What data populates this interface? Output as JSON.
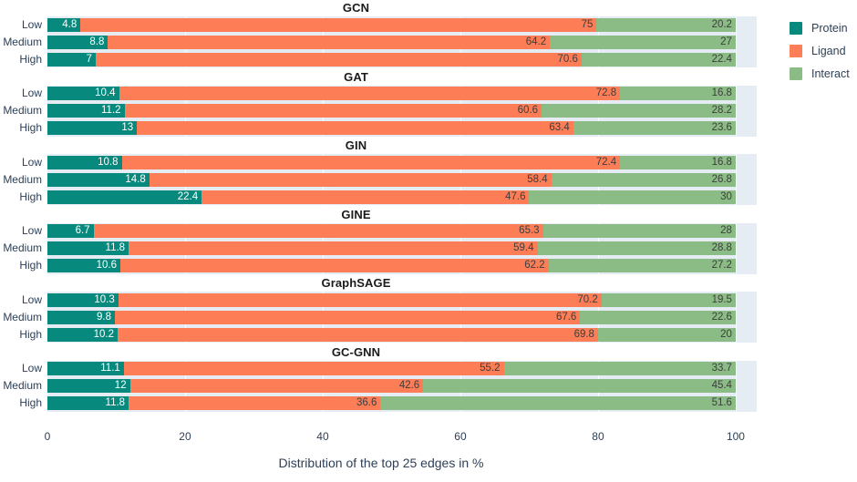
{
  "chart_data": {
    "type": "bar",
    "orientation": "horizontal",
    "stacked": true,
    "normalized": true,
    "title": "",
    "xlabel": "Distribution of the top 25 edges in %",
    "ylabel": "",
    "xlim": [
      0,
      100
    ],
    "xticks": [
      0,
      20,
      40,
      60,
      80,
      100
    ],
    "xticklabels": [
      "0",
      "20",
      "40",
      "60",
      "80",
      "100"
    ],
    "grid": true,
    "legend_position": "right",
    "categories": [
      "Low",
      "Medium",
      "High"
    ],
    "series_names": [
      "Protein",
      "Ligand",
      "Interact"
    ],
    "colors": {
      "Protein": "#078a7d",
      "Ligand": "#fc7d56",
      "Interact": "#8cbc86",
      "panel_background": "#e6ecf3",
      "text": "#2e4057",
      "title": "#1a1a1a"
    },
    "panels": [
      {
        "title": "GCN",
        "rows": [
          {
            "label": "Low",
            "values": [
              4.8,
              75.0,
              20.2
            ],
            "labels": [
              "4.8",
              "75",
              "20.2"
            ]
          },
          {
            "label": "Medium",
            "values": [
              8.8,
              64.2,
              27.0
            ],
            "labels": [
              "8.8",
              "64.2",
              "27"
            ]
          },
          {
            "label": "High",
            "values": [
              7.0,
              70.6,
              22.4
            ],
            "labels": [
              "7",
              "70.6",
              "22.4"
            ]
          }
        ]
      },
      {
        "title": "GAT",
        "rows": [
          {
            "label": "Low",
            "values": [
              10.4,
              72.8,
              16.8
            ],
            "labels": [
              "10.4",
              "72.8",
              "16.8"
            ]
          },
          {
            "label": "Medium",
            "values": [
              11.2,
              60.6,
              28.2
            ],
            "labels": [
              "11.2",
              "60.6",
              "28.2"
            ]
          },
          {
            "label": "High",
            "values": [
              13.0,
              63.4,
              23.6
            ],
            "labels": [
              "13",
              "63.4",
              "23.6"
            ]
          }
        ]
      },
      {
        "title": "GIN",
        "rows": [
          {
            "label": "Low",
            "values": [
              10.8,
              72.4,
              16.8
            ],
            "labels": [
              "10.8",
              "72.4",
              "16.8"
            ]
          },
          {
            "label": "Medium",
            "values": [
              14.8,
              58.4,
              26.8
            ],
            "labels": [
              "14.8",
              "58.4",
              "26.8"
            ]
          },
          {
            "label": "High",
            "values": [
              22.4,
              47.6,
              30.0
            ],
            "labels": [
              "22.4",
              "47.6",
              "30"
            ]
          }
        ]
      },
      {
        "title": "GINE",
        "rows": [
          {
            "label": "Low",
            "values": [
              6.7,
              65.3,
              28.0
            ],
            "labels": [
              "6.7",
              "65.3",
              "28"
            ]
          },
          {
            "label": "Medium",
            "values": [
              11.8,
              59.4,
              28.8
            ],
            "labels": [
              "11.8",
              "59.4",
              "28.8"
            ]
          },
          {
            "label": "High",
            "values": [
              10.6,
              62.2,
              27.2
            ],
            "labels": [
              "10.6",
              "62.2",
              "27.2"
            ]
          }
        ]
      },
      {
        "title": "GraphSAGE",
        "rows": [
          {
            "label": "Low",
            "values": [
              10.3,
              70.2,
              19.5
            ],
            "labels": [
              "10.3",
              "70.2",
              "19.5"
            ]
          },
          {
            "label": "Medium",
            "values": [
              9.8,
              67.6,
              22.6
            ],
            "labels": [
              "9.8",
              "67.6",
              "22.6"
            ]
          },
          {
            "label": "High",
            "values": [
              10.2,
              69.8,
              20.0
            ],
            "labels": [
              "10.2",
              "69.8",
              "20"
            ]
          }
        ]
      },
      {
        "title": "GC-GNN",
        "rows": [
          {
            "label": "Low",
            "values": [
              11.1,
              55.2,
              33.7
            ],
            "labels": [
              "11.1",
              "55.2",
              "33.7"
            ]
          },
          {
            "label": "Medium",
            "values": [
              12.0,
              42.6,
              45.4
            ],
            "labels": [
              "12",
              "42.6",
              "45.4"
            ]
          },
          {
            "label": "High",
            "values": [
              11.8,
              36.6,
              51.6
            ],
            "labels": [
              "11.8",
              "36.6",
              "51.6"
            ]
          }
        ]
      }
    ],
    "legend": [
      {
        "name": "Protein",
        "color": "#078a7d"
      },
      {
        "name": "Ligand",
        "color": "#fc7d56"
      },
      {
        "name": "Interact",
        "color": "#8cbc86"
      }
    ]
  }
}
